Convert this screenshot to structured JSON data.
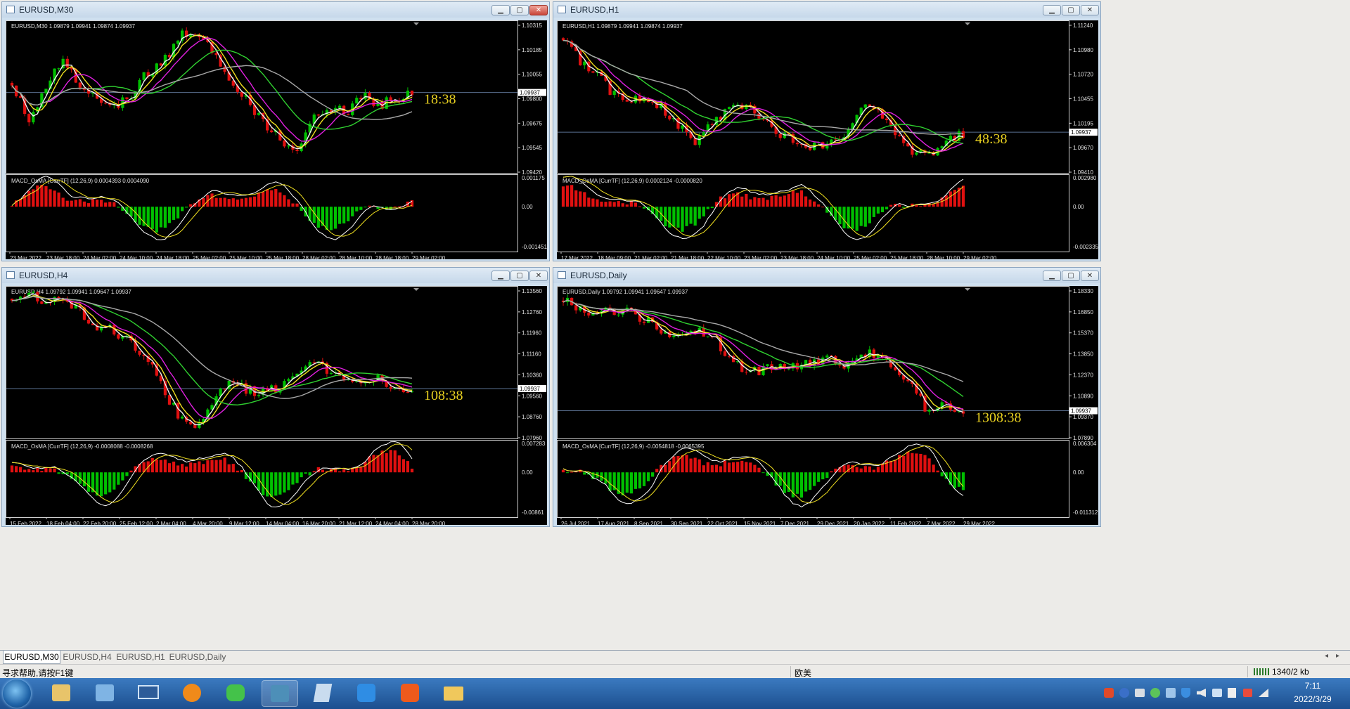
{
  "charts": [
    {
      "title": "EURUSD,M30",
      "info": "EURUSD,M30  1.09879 1.09941 1.09874 1.09937",
      "macd": "MACD_OsMA [CurrTF] (12,26,9) 0.0004393 0.0004090",
      "timer": "18:38",
      "current": "1.09937",
      "prices": [
        "1.10315",
        "1.10185",
        "1.10055",
        "1.09800",
        "1.09675",
        "1.09545",
        "1.09420"
      ],
      "macd_ticks": [
        "0.001175",
        "0.00",
        "-0.001451"
      ],
      "dates": [
        "23 Mar 2022",
        "23 Mar 18:00",
        "24 Mar 02:00",
        "24 Mar 10:00",
        "24 Mar 18:00",
        "25 Mar 02:00",
        "25 Mar 10:00",
        "25 Mar 18:00",
        "28 Mar 02:00",
        "28 Mar 10:00",
        "28 Mar 18:00",
        "29 Mar 02:00"
      ],
      "range": [
        1.0942,
        1.104
      ],
      "path": [
        1.1,
        1.0975,
        1.0995,
        1.1015,
        1.1,
        1.099,
        1.0982,
        1.099,
        1.1005,
        1.1012,
        1.103,
        1.1035,
        1.102,
        1.1005,
        1.099,
        1.0975,
        1.0965,
        1.0955,
        1.0975,
        1.0985,
        1.098,
        1.0992,
        1.0985,
        1.099,
        1.0994
      ]
    },
    {
      "title": "EURUSD,H1",
      "info": "EURUSD,H1  1.09879 1.09941 1.09874 1.09937",
      "macd": "MACD_OsMA [CurrTF] (12,26,9) 0.0002124 -0.0000820",
      "timer": "48:38",
      "current": "1.09937",
      "prices": [
        "1.11240",
        "1.10980",
        "1.10720",
        "1.10455",
        "1.10195",
        "1.09670",
        "1.09410"
      ],
      "macd_ticks": [
        "0.002980",
        "0.00",
        "-0.002335"
      ],
      "dates": [
        "17 Mar 2022",
        "18 Mar 09:00",
        "21 Mar 02:00",
        "21 Mar 18:00",
        "22 Mar 10:00",
        "23 Mar 02:00",
        "23 Mar 18:00",
        "24 Mar 10:00",
        "25 Mar 02:00",
        "25 Mar 18:00",
        "28 Mar 10:00",
        "29 Mar 02:00"
      ],
      "range": [
        1.0941,
        1.1142
      ],
      "path": [
        1.112,
        1.109,
        1.107,
        1.1045,
        1.104,
        1.1038,
        1.1025,
        1.1,
        1.098,
        1.101,
        1.1025,
        1.103,
        1.101,
        1.099,
        1.0985,
        1.0975,
        1.098,
        1.0995,
        1.103,
        1.102,
        1.099,
        1.0965,
        1.096,
        1.0985,
        1.099
      ]
    },
    {
      "title": "EURUSD,H4",
      "info": "EURUSD,H4  1.09792 1.09941 1.09647 1.09937",
      "macd": "MACD_OsMA [CurrTF] (12,26,9) -0.0008088 -0.0008268",
      "timer": "108:38",
      "current": "1.09937",
      "prices": [
        "1.13560",
        "1.12760",
        "1.11960",
        "1.11160",
        "1.10360",
        "1.09560",
        "1.08760",
        "1.07960"
      ],
      "macd_ticks": [
        "0.007283",
        "0.00",
        "-0.00861"
      ],
      "dates": [
        "15 Feb 2022",
        "18 Feb 04:00",
        "22 Feb 20:00",
        "25 Feb 12:00",
        "2 Mar 04:00",
        "4 Mar 20:00",
        "9 Mar 12:00",
        "14 Mar 04:00",
        "16 Mar 20:00",
        "21 Mar 12:00",
        "24 Mar 04:00",
        "28 Mar 20:00"
      ],
      "range": [
        1.0796,
        1.1406
      ],
      "path": [
        1.136,
        1.137,
        1.1355,
        1.134,
        1.131,
        1.125,
        1.123,
        1.119,
        1.113,
        1.1,
        1.088,
        1.085,
        1.092,
        1.103,
        1.099,
        1.098,
        1.1,
        1.104,
        1.111,
        1.106,
        1.104,
        1.102,
        1.103,
        1.1,
        1.0994
      ]
    },
    {
      "title": "EURUSD,Daily",
      "info": "EURUSD,Daily  1.09792 1.09941 1.09647 1.09937",
      "macd": "MACD_OsMA [CurrTF] (12,26,9) -0.0054818 -0.0065395",
      "timer": "1308:38",
      "current": "1.09937",
      "prices": [
        "1.18330",
        "1.16850",
        "1.15370",
        "1.13850",
        "1.12370",
        "1.10890",
        "1.09370",
        "1.07890"
      ],
      "macd_ticks": [
        "0.006304",
        "0.00",
        "-0.011312"
      ],
      "dates": [
        "26 Jul 2021",
        "17 Aug 2021",
        "8 Sep 2021",
        "30 Sep 2021",
        "22 Oct 2021",
        "15 Nov 2021",
        "7 Dec 2021",
        "29 Dec 2021",
        "20 Jan 2022",
        "11 Feb 2022",
        "7 Mar 2022",
        "29 Mar 2022"
      ],
      "range": [
        1.0789,
        1.1953
      ],
      "path": [
        1.185,
        1.18,
        1.173,
        1.178,
        1.176,
        1.17,
        1.162,
        1.158,
        1.161,
        1.156,
        1.14,
        1.128,
        1.132,
        1.135,
        1.134,
        1.136,
        1.142,
        1.132,
        1.145,
        1.14,
        1.133,
        1.12,
        1.095,
        1.105,
        1.0994
      ]
    }
  ],
  "tabs": [
    "EURUSD,M30",
    "EURUSD,H4",
    "EURUSD,H1",
    "EURUSD,Daily"
  ],
  "status": {
    "help": "寻求帮助,请按F1键",
    "profile": "欧美",
    "traffic": "1340/2 kb"
  },
  "tray": {
    "time": "7:11",
    "date": "2022/3/29"
  },
  "colors": {
    "bull": "#00c000",
    "bear": "#e01010",
    "ma_white": "#f0f0f0",
    "ma_yellow": "#f0e020",
    "ma_magenta": "#e020e0",
    "ma_green": "#30d030",
    "ma_gray": "#a8a8a8",
    "timer": "#e8d020"
  }
}
